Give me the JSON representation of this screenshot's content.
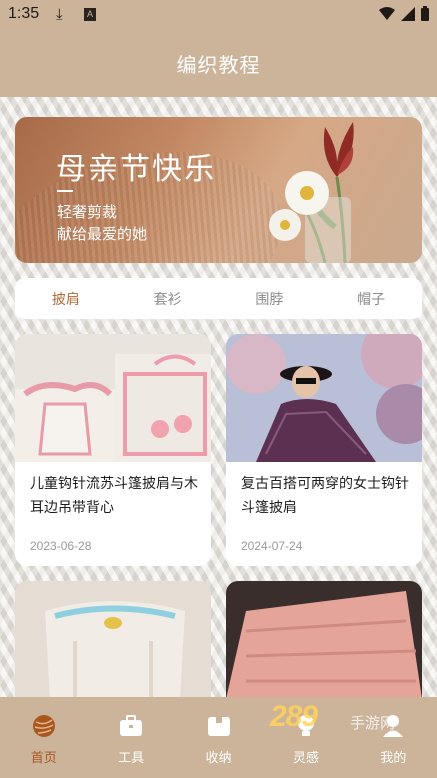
{
  "status_bar": {
    "time": "1:35",
    "icons": [
      "download-icon",
      "a-badge-icon",
      "wifi-icon",
      "signal-icon",
      "battery-icon"
    ]
  },
  "header": {
    "title": "编织教程"
  },
  "banner": {
    "headline": "母亲节快乐",
    "line1": "轻奢剪裁",
    "line2": "献给最爱的她"
  },
  "tabs": [
    {
      "label": "披肩",
      "active": true
    },
    {
      "label": "套衫",
      "active": false
    },
    {
      "label": "围脖",
      "active": false
    },
    {
      "label": "帽子",
      "active": false
    }
  ],
  "cards": [
    {
      "title": "儿童钩针流苏斗篷披肩与木耳边吊带背心",
      "date": "2023-06-28"
    },
    {
      "title": "复古百搭可两穿的女士钩针斗篷披肩",
      "date": "2024-07-24"
    }
  ],
  "bottom_nav": [
    {
      "label": "首页",
      "icon": "yarn-ball-icon",
      "active": true
    },
    {
      "label": "工具",
      "icon": "toolbox-icon",
      "active": false
    },
    {
      "label": "收纳",
      "icon": "storage-box-icon",
      "active": false
    },
    {
      "label": "灵感",
      "icon": "lightbulb-icon",
      "active": false
    },
    {
      "label": "我的",
      "icon": "profile-icon",
      "active": false
    }
  ],
  "watermark": {
    "text": "289",
    "sub": "手游网"
  },
  "colors": {
    "accent": "#ccb49a",
    "active_tab": "#b06a36",
    "nav_active": "#a8571f"
  }
}
